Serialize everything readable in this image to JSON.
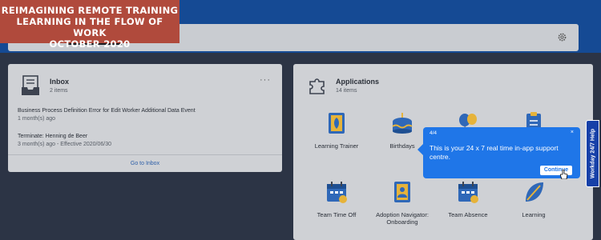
{
  "banner": {
    "line1": "REIMAGINING REMOTE TRAINING",
    "line2": "LEARNING IN THE FLOW OF WORK",
    "line3": "OCTOBER 2020"
  },
  "inbox": {
    "title": "Inbox",
    "subtitle": "2 items",
    "more": "···",
    "items": [
      {
        "title": "Business Process Definition Error for Edit Worker Additional Data Event",
        "meta": "1 month(s) ago"
      },
      {
        "title": "Terminate: Henning de Beer",
        "meta": "3 month(s) ago - Effective 2020/06/30"
      }
    ],
    "goto": "Go to Inbox"
  },
  "applications": {
    "title": "Applications",
    "subtitle": "14 items",
    "items": [
      {
        "label": "Learning Trainer",
        "icon": "notebook-icon"
      },
      {
        "label": "Birthdays",
        "icon": "cake-icon"
      },
      {
        "label": "",
        "icon": "balloons-icon"
      },
      {
        "label": "",
        "icon": "clipboard-icon"
      },
      {
        "label": "Team Time Off",
        "icon": "calendar-team-icon"
      },
      {
        "label": "Adoption Navigator: Onboarding",
        "icon": "navigator-icon"
      },
      {
        "label": "Team Absence",
        "icon": "calendar-absence-icon"
      },
      {
        "label": "Learning",
        "icon": "leaf-icon"
      }
    ]
  },
  "tooltip": {
    "step": "4/4",
    "close": "×",
    "message": "This is your 24 x 7 real time in-app support centre.",
    "continue": "Continue"
  },
  "help_tab": {
    "label": "Workday 24/7 Help"
  },
  "colors": {
    "banner": "#b04a3c",
    "header_blue": "#154a94",
    "tooltip_blue": "#1f76e8",
    "help_tab": "#1640a8"
  }
}
